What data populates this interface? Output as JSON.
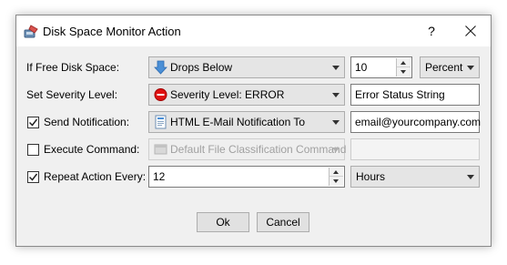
{
  "window": {
    "title": "Disk Space Monitor Action",
    "help_label": "?"
  },
  "rows": {
    "free_space": {
      "label": "If Free Disk Space:",
      "condition": "Drops Below",
      "value": "10",
      "unit": "Percent"
    },
    "severity": {
      "label": "Set Severity Level:",
      "level": "Severity Level: ERROR",
      "status_string": "Error Status String"
    },
    "notification": {
      "label": "Send Notification:",
      "checked": true,
      "method": "HTML E-Mail Notification To",
      "email": "email@yourcompany.com"
    },
    "execute": {
      "label": "Execute Command:",
      "checked": false,
      "command": "Default File Classification Command",
      "enabled": false
    },
    "repeat": {
      "label": "Repeat Action Every:",
      "checked": true,
      "value": "12",
      "unit": "Hours"
    }
  },
  "buttons": {
    "ok": "Ok",
    "cancel": "Cancel"
  },
  "colors": {
    "dialog_bg": "#f0f0f0",
    "titlebar_bg": "#ffffff",
    "severity_red": "#e01010",
    "arrow_blue": "#4a8fd6"
  }
}
